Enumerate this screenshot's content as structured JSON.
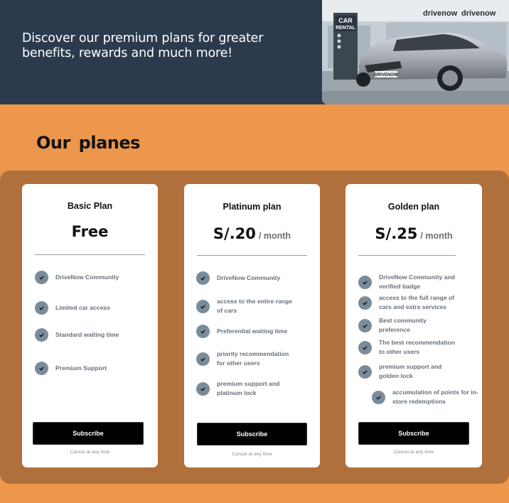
{
  "hero": {
    "tagline": "Discover our premium plans for greater benefits, rewards and much more!",
    "image": {
      "description_icon": "car-rental-photo",
      "sign_top": "CAR",
      "sign_bottom": "RENTAL",
      "store_sign_left": "drivenow",
      "store_sign_right": "drivenow",
      "plate": "DRIVENOW"
    }
  },
  "section": {
    "title": "Our  planes"
  },
  "plans": [
    {
      "name": "Basic Plan",
      "price": "Free",
      "period": "",
      "features": [
        "DriveNow Community",
        "Limited car access",
        "Standard waiting time",
        "Premium Support"
      ],
      "button": "Subscribe",
      "cancel_note": "Cancel at any time"
    },
    {
      "name": "Platinum plan",
      "price": "S/.20",
      "period": "/ month",
      "features": [
        "DriveNow Community",
        "access to the entire range of cars",
        "Preferential waiting time",
        "priority recommendation for other users",
        "premium support and platinum lock"
      ],
      "button": "Subscribe",
      "cancel_note": "Cancel at any time"
    },
    {
      "name": "Golden plan",
      "price": "S/.25",
      "period": "/ month",
      "features": [
        "DriveNow Community and verified badge",
        "access to the full range of cars and extra services",
        "Best community preference",
        "The best recommendation to other users",
        "premium support and golden lock",
        "accumulation of points for in-store redemptions"
      ],
      "button": "Subscribe",
      "cancel_note": "Cancel at any time"
    }
  ],
  "colors": {
    "page_background": "#ec974c",
    "hero_background": "#2c3a4e",
    "panel_background": "#b0703b",
    "card_background": "#ffffff",
    "check_circle": "#7a8c99",
    "button_background": "#000000"
  }
}
